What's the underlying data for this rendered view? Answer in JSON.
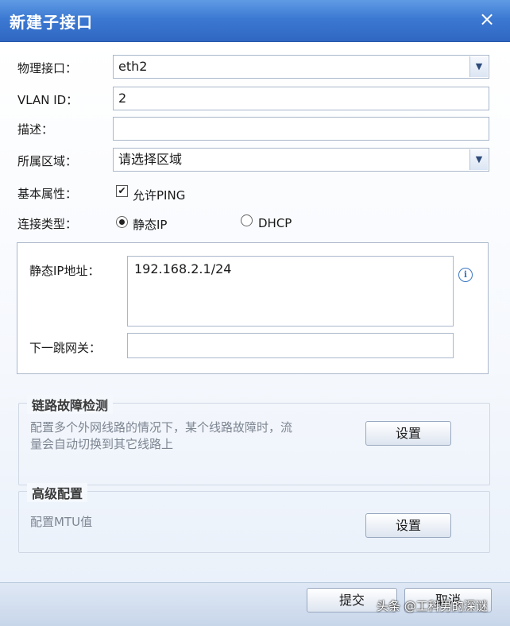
{
  "dialog": {
    "title": "新建子接口",
    "close_icon": "×"
  },
  "form": {
    "interface_label": "物理接口：",
    "interface_value": "eth2",
    "vlan_label": "VLAN ID：",
    "vlan_value": "2",
    "desc_label": "描述：",
    "desc_value": "",
    "zone_label": "所属区域：",
    "zone_value": "请选择区域",
    "basic_label": "基本属性：",
    "allow_ping_label": "允许PING",
    "allow_ping_checked": true,
    "conn_label": "连接类型：",
    "conn_options": [
      "静态IP",
      "DHCP"
    ],
    "conn_selected": "静态IP"
  },
  "static_panel": {
    "ip_label": "静态IP地址：",
    "ip_value": "192.168.2.1/24",
    "gateway_label": "下一跳网关：",
    "gateway_value": ""
  },
  "link_detect": {
    "title": "链路故障检测",
    "desc_line1": "配置多个外网线路的情况下，某个线路故障时，流",
    "desc_line2": "量会自动切换到其它线路上",
    "button": "设置"
  },
  "advanced": {
    "title": "高级配置",
    "desc": "配置MTU值",
    "button": "设置"
  },
  "footer": {
    "submit": "提交",
    "cancel": "取消"
  },
  "watermark": "头条 @工科男的深谜",
  "colors": {
    "title_bar": "#3c79d2",
    "field_border": "#a9b7cb",
    "info_icon": "#3a78c6"
  }
}
